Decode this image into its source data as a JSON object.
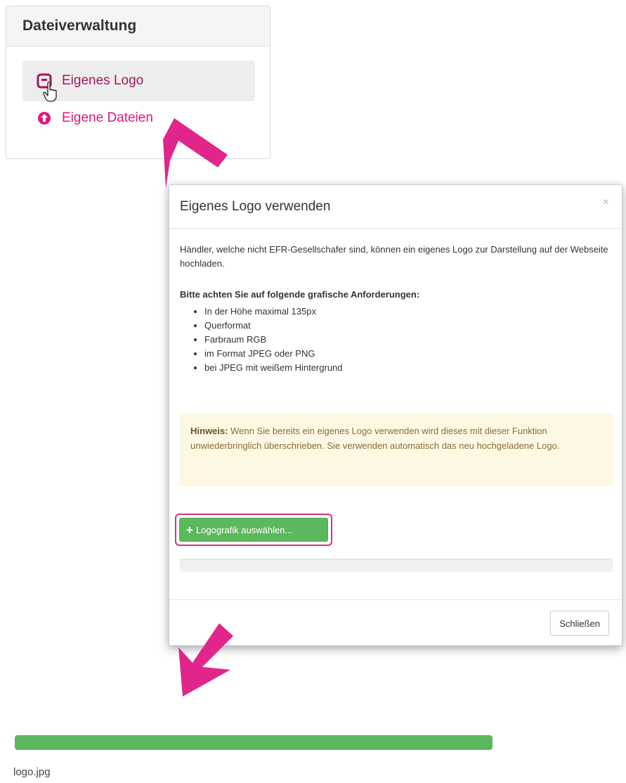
{
  "colors": {
    "accent": "#e0177c",
    "success": "#5cb85c",
    "warning_bg": "#fcf8e3",
    "arrow": "#e0268a"
  },
  "panel": {
    "title": "Dateiverwaltung",
    "items": [
      {
        "label": "Eigenes Logo",
        "icon": "logo-image-icon",
        "active": true
      },
      {
        "label": "Eigene Dateien",
        "icon": "upload-circle-icon",
        "active": false
      }
    ]
  },
  "modal": {
    "title": "Eigenes Logo verwenden",
    "close_symbol": "×",
    "intro": "Händler, welche nicht EFR-Gesellschafer sind, können ein eigenes Logo zur Darstellung auf der Webseite hochladen.",
    "requirements_title": "Bitte achten Sie auf folgende grafische Anforderungen:",
    "requirements": [
      "In der Höhe maximal 135px",
      "Querformat",
      "Farbraum RGB",
      "im Format JPEG oder PNG",
      "bei JPEG mit weißem Hintergrund"
    ],
    "note_label": "Hinweis:",
    "note_text": " Wenn Sie bereits ein eigenes Logo verwenden wird dieses mit dieser Funktion unwiederbringlich überschrieben. Sie verwenden automatisch das neu hochgeladene Logo.",
    "upload_label": "Logografik auswählen...",
    "close_label": "Schließen"
  },
  "upload_result": {
    "progress": 1.0,
    "filename": "logo.jpg"
  }
}
